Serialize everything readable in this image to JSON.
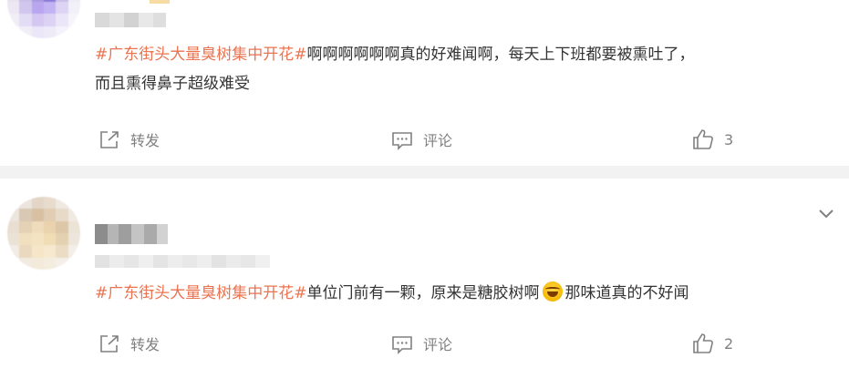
{
  "posts": [
    {
      "hashtag": "#广东街头大量臭树集中开花#",
      "text_line1": "啊啊啊啊啊啊真的好难闻啊，每天上下班都要被熏吐了，",
      "text_line2": "而且熏得鼻子超级难受",
      "actions": {
        "forward_label": "转发",
        "comment_label": "评论",
        "like_count": "3"
      }
    },
    {
      "hashtag": "#广东街头大量臭树集中开花#",
      "text_before_emoji": "单位门前有一颗，原来是糖胶树啊",
      "emoji": "laughing-crying-emoji",
      "text_after_emoji": "那味道真的不好闻",
      "actions": {
        "forward_label": "转发",
        "comment_label": "评论",
        "like_count": "2"
      }
    }
  ],
  "colors": {
    "hashtag": "#eb7350",
    "text": "#333333",
    "action_text": "#808080",
    "separator": "#f2f2f2"
  },
  "icons": {
    "forward": "forward-icon",
    "comment": "comment-icon",
    "like": "thumbs-up-icon",
    "collapse": "chevron-down-icon"
  }
}
